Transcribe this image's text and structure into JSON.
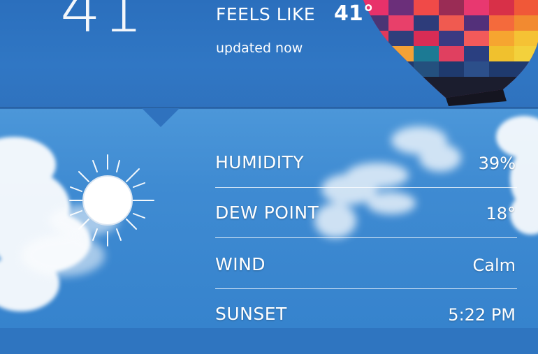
{
  "current": {
    "temperature": "41",
    "feels_like_label": "FEELS LIKE",
    "feels_like_value": "41°",
    "updated_text": "updated now"
  },
  "condition_icon": "sun-icon",
  "details": [
    {
      "label": "HUMIDITY",
      "value": "39%"
    },
    {
      "label": "DEW POINT",
      "value": "18°"
    },
    {
      "label": "WIND",
      "value": "Calm"
    },
    {
      "label": "SUNSET",
      "value": "5:22 PM"
    }
  ],
  "colors": {
    "top_background": "#2f75c0",
    "sky_background": "#4c97d9",
    "text": "#ffffff"
  }
}
